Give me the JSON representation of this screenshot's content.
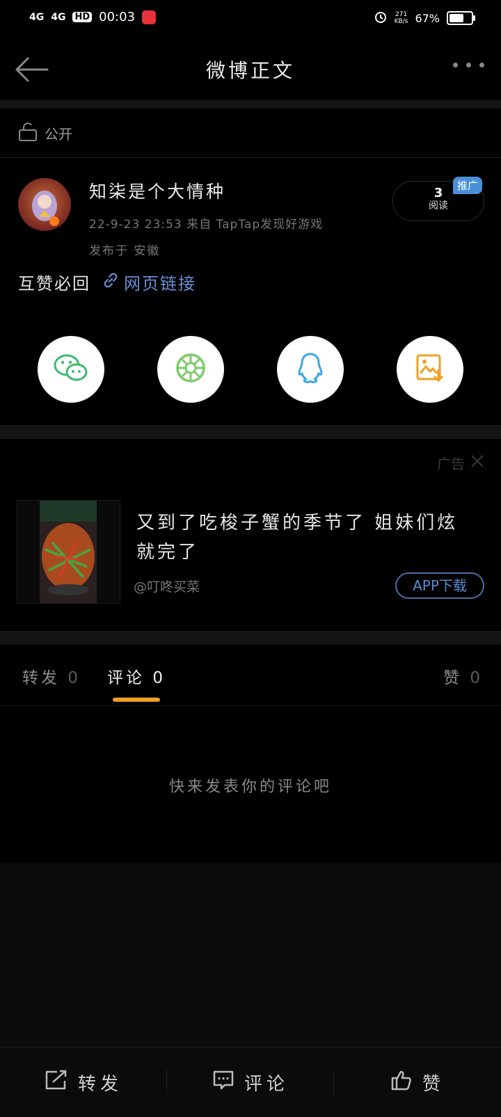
{
  "status_bar": {
    "signal1": "4G",
    "signal2": "4G",
    "hd": "HD",
    "time": "00:03",
    "net_speed_value": "271",
    "net_speed_unit": "KB/s",
    "battery": "67%",
    "battery_level": 0.67
  },
  "nav": {
    "title": "微博正文"
  },
  "post": {
    "visibility": "公开",
    "username": "知柒是个大情种",
    "date_source": "22-9-23 23:53  来自 TapTap发现好游戏",
    "location": "发布于 安徽",
    "reads_count": "3",
    "reads_label": "阅读",
    "promo_badge": "推广",
    "text": "互赞必回",
    "link_text": "网页链接"
  },
  "share": [
    {
      "name": "wechat-icon"
    },
    {
      "name": "moments-icon"
    },
    {
      "name": "qq-icon"
    },
    {
      "name": "save-image-icon"
    }
  ],
  "ad": {
    "label": "广告",
    "title": "又到了吃梭子蟹的季节了 姐妹们炫就完了",
    "source": "@叮咚买菜",
    "button": "APP下载"
  },
  "tabs": {
    "repost_label": "转发",
    "repost_count": "0",
    "comment_label": "评论",
    "comment_count": "0",
    "like_label": "赞",
    "like_count": "0"
  },
  "empty_state": "快来发表你的评论吧",
  "bottom_bar": {
    "repost": "转发",
    "comment": "评论",
    "like": "赞"
  },
  "colors": {
    "accent": "#f0a020",
    "link": "#6b8fd4",
    "promo": "#4a90d9"
  }
}
